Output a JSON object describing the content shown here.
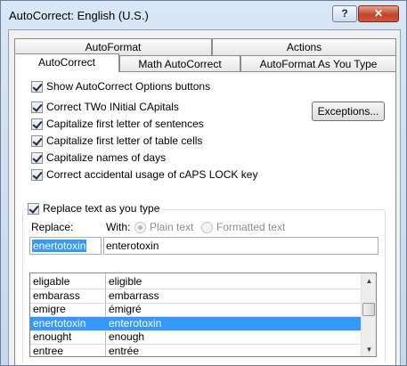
{
  "window": {
    "title": "AutoCorrect: English (U.S.)",
    "help_label": "?",
    "close_label": "✕"
  },
  "tabs": {
    "row1": [
      "AutoFormat",
      "Actions"
    ],
    "row2": [
      "AutoCorrect",
      "Math AutoCorrect",
      "AutoFormat As You Type"
    ],
    "active": "AutoCorrect"
  },
  "options": {
    "show_buttons": {
      "label": "Show AutoCorrect Options buttons",
      "checked": true
    },
    "items": [
      {
        "label": "Correct TWo INitial CApitals",
        "checked": true
      },
      {
        "label": "Capitalize first letter of sentences",
        "checked": true
      },
      {
        "label": "Capitalize first letter of table cells",
        "checked": true
      },
      {
        "label": "Capitalize names of days",
        "checked": true
      },
      {
        "label": "Correct accidental usage of cAPS LOCK key",
        "checked": true
      }
    ],
    "exceptions_label": "Exceptions..."
  },
  "replace_section": {
    "checkbox_label": "Replace text as you type",
    "checked": true,
    "replace_label": "Replace:",
    "with_label": "With:",
    "plain_text_label": "Plain text",
    "formatted_text_label": "Formatted text",
    "replace_value": "enertotoxin",
    "with_value": "enterotoxin"
  },
  "entries": [
    {
      "from": "eligable",
      "to": "eligible"
    },
    {
      "from": "embarass",
      "to": "embarrass"
    },
    {
      "from": "emigre",
      "to": "émigré"
    },
    {
      "from": "enertotoxin",
      "to": "enterotoxin",
      "selected": true
    },
    {
      "from": "enought",
      "to": "enough"
    },
    {
      "from": "entree",
      "to": "entrée"
    }
  ],
  "colors": {
    "selection": "#3399ff",
    "title_gradient": "#c7d8ee",
    "close_button": "#c0452b"
  }
}
